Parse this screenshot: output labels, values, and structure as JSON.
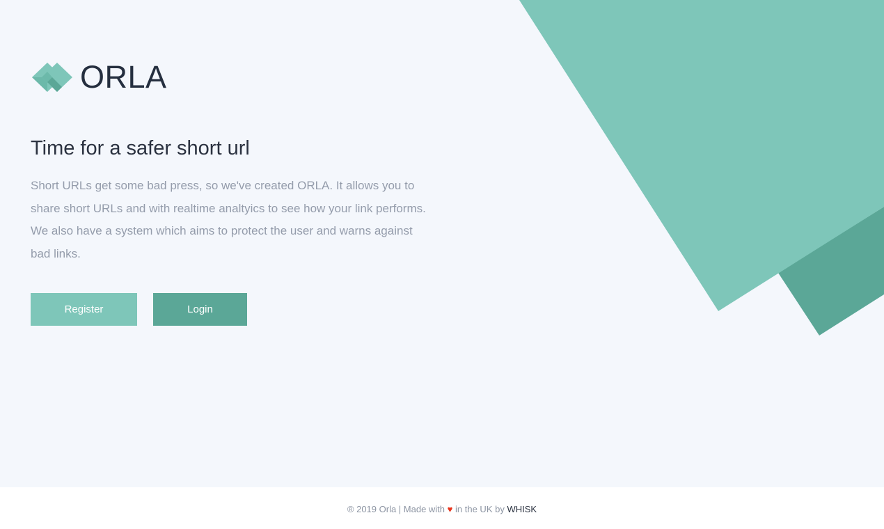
{
  "brand": {
    "name": "ORLA",
    "logo_icon": "heart-diamond-logo-icon"
  },
  "hero": {
    "title": "Time for a safer short url",
    "description": "Short URLs get some bad press, so we've created ORLA. It allows you to share short URLs and with realtime analtyics to see how your link performs. We also have a system which aims to protect the user and warns against bad links."
  },
  "actions": {
    "register_label": "Register",
    "login_label": "Login"
  },
  "footer": {
    "copyright": "® 2019 Orla | Made with",
    "heart": "♥",
    "location": "in the UK by",
    "maker": "WHISK"
  },
  "colors": {
    "background": "#f4f7fc",
    "accent_light": "#7ec6b9",
    "accent_dark": "#5ba797",
    "heading": "#2b3240",
    "body_text": "#949cab",
    "heart": "#e8341c"
  }
}
